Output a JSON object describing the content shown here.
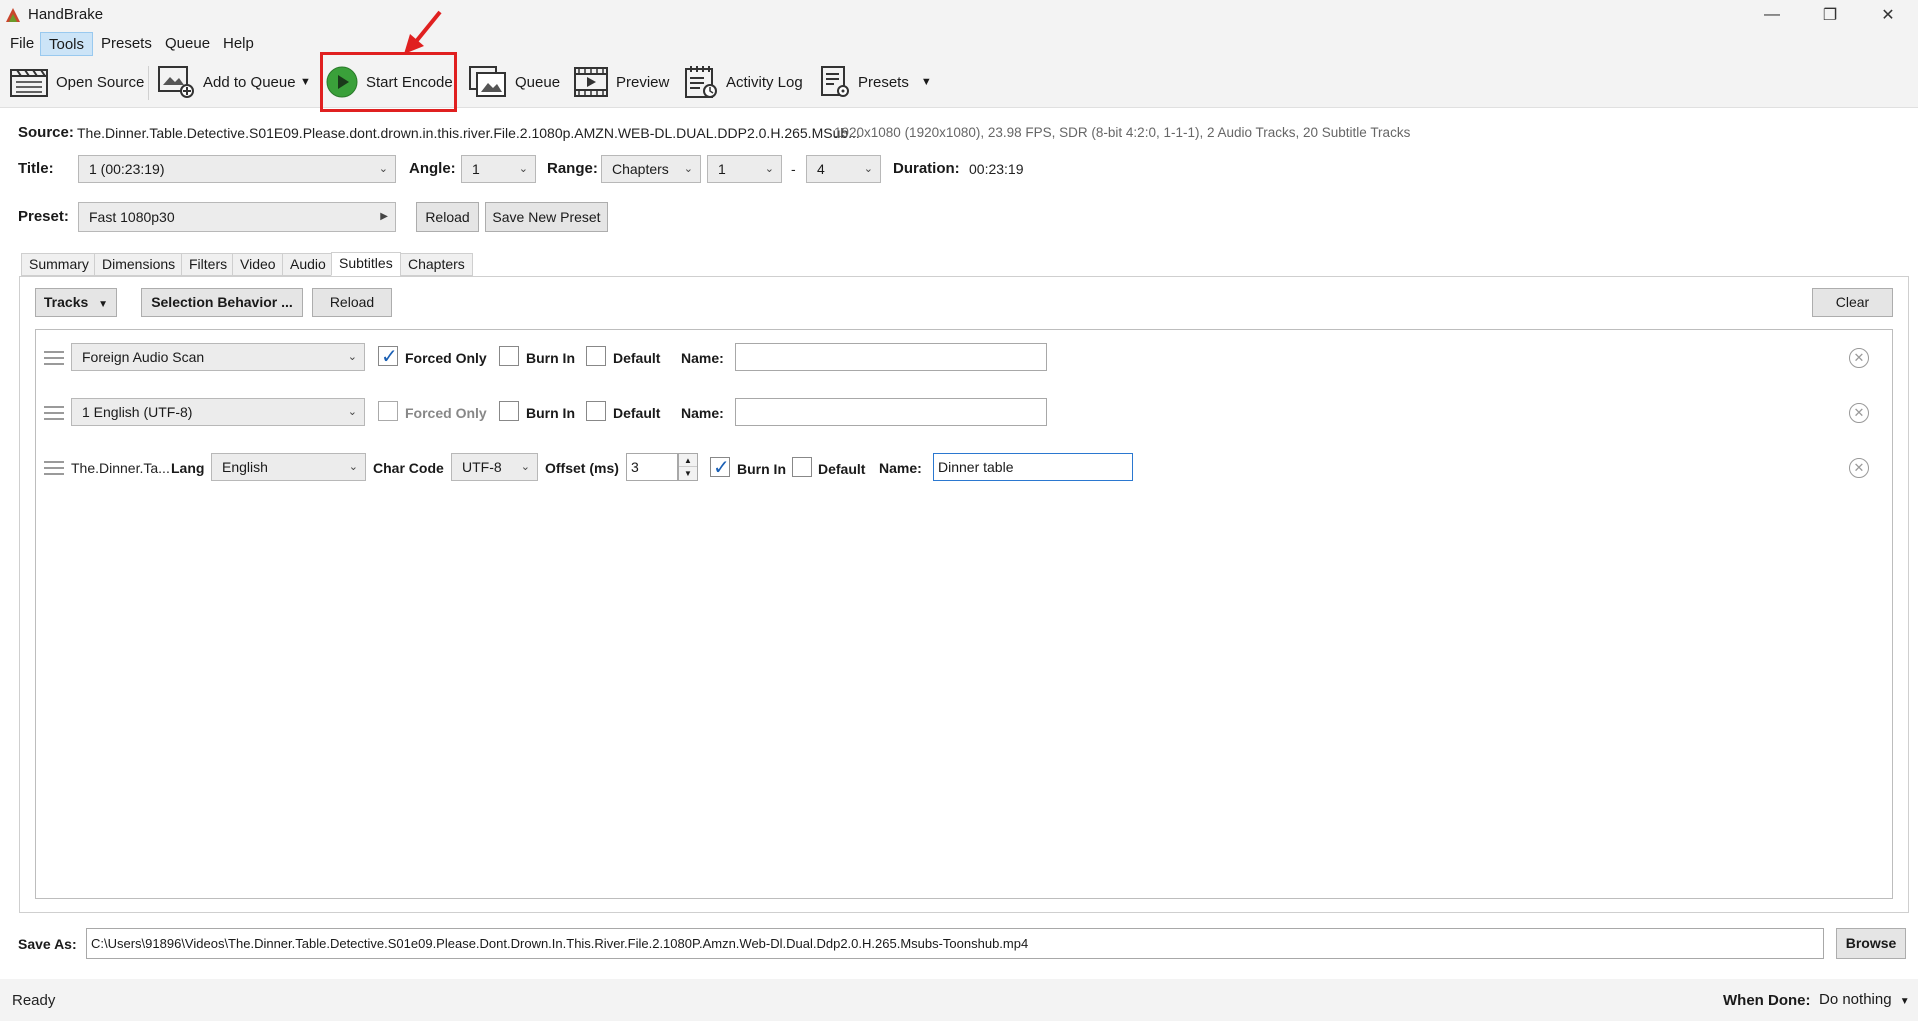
{
  "window": {
    "title": "HandBrake"
  },
  "menu": {
    "items": [
      "File",
      "Tools",
      "Presets",
      "Queue",
      "Help"
    ]
  },
  "toolbar": {
    "open_source": "Open Source",
    "add_to_queue": "Add to Queue",
    "start_encode": "Start Encode",
    "queue": "Queue",
    "preview": "Preview",
    "activity_log": "Activity Log",
    "presets": "Presets"
  },
  "source": {
    "label": "Source:",
    "name": "The.Dinner.Table.Detective.S01E09.Please.dont.drown.in.this.river.File.2.1080p.AMZN.WEB-DL.DUAL.DDP2.0.H.265.MSub...",
    "info": "1920x1080 (1920x1080), 23.98 FPS, SDR (8-bit 4:2:0, 1-1-1), 2 Audio Tracks, 20 Subtitle Tracks"
  },
  "title_row": {
    "title_label": "Title:",
    "title_value": "1  (00:23:19)",
    "angle_label": "Angle:",
    "angle_value": "1",
    "range_label": "Range:",
    "range_value": "Chapters",
    "range_start": "1",
    "range_sep": "-",
    "range_end": "4",
    "duration_label": "Duration:",
    "duration_value": "00:23:19"
  },
  "preset_row": {
    "label": "Preset:",
    "value": "Fast 1080p30",
    "reload": "Reload",
    "save_new": "Save New Preset"
  },
  "tabs": [
    "Summary",
    "Dimensions",
    "Filters",
    "Video",
    "Audio",
    "Subtitles",
    "Chapters"
  ],
  "subtitles": {
    "tracks_btn": "Tracks",
    "selection_behavior_btn": "Selection Behavior ...",
    "reload_btn": "Reload",
    "clear_btn": "Clear",
    "forced_only": "Forced Only",
    "burn_in": "Burn In",
    "default": "Default",
    "name_label": "Name:",
    "rows": [
      {
        "track": "Foreign Audio Scan",
        "forced": true,
        "burn": false,
        "default": false,
        "name": ""
      },
      {
        "track": "1 English (UTF-8)",
        "forced": false,
        "burn": false,
        "default": false,
        "name": ""
      }
    ],
    "file_row": {
      "file": "The.Dinner.Ta...",
      "lang_label": "Lang",
      "lang_value": "English",
      "charcode_label": "Char Code",
      "charcode_value": "UTF-8",
      "offset_label": "Offset (ms)",
      "offset_value": "3",
      "burn_in": true,
      "default": false,
      "name": "Dinner table"
    }
  },
  "save_as": {
    "label": "Save As:",
    "path": "C:\\Users\\91896\\Videos\\The.Dinner.Table.Detective.S01e09.Please.Dont.Drown.In.This.River.File.2.1080P.Amzn.Web-Dl.Dual.Ddp2.0.H.265.Msubs-Toonshub.mp4",
    "browse": "Browse"
  },
  "status": {
    "text": "Ready",
    "when_done_label": "When Done:",
    "when_done_value": "Do nothing"
  },
  "colors": {
    "highlight": "#e02020",
    "play_green": "#3aa03a",
    "check_blue": "#1a5fb4"
  }
}
